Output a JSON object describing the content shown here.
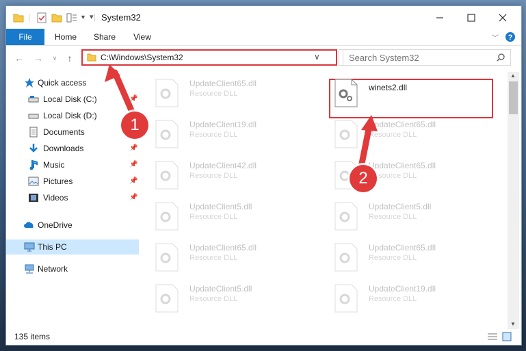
{
  "window": {
    "title": "System32"
  },
  "ribbon": {
    "tabs": [
      "File",
      "Home",
      "Share",
      "View"
    ]
  },
  "nav": {
    "address": "C:\\Windows\\System32",
    "search_placeholder": "Search System32"
  },
  "sidebar": {
    "items": [
      {
        "label": "Quick access",
        "icon": "star-icon",
        "pinned": false,
        "level": 0
      },
      {
        "label": "Local Disk (C:)",
        "icon": "drive-icon",
        "pinned": true,
        "level": 1
      },
      {
        "label": "Local Disk (D:)",
        "icon": "drive-icon",
        "pinned": false,
        "level": 1
      },
      {
        "label": "Documents",
        "icon": "documents-icon",
        "pinned": true,
        "level": 1
      },
      {
        "label": "Downloads",
        "icon": "download-icon",
        "pinned": true,
        "level": 1
      },
      {
        "label": "Music",
        "icon": "music-icon",
        "pinned": true,
        "level": 1
      },
      {
        "label": "Pictures",
        "icon": "pictures-icon",
        "pinned": true,
        "level": 1
      },
      {
        "label": "Videos",
        "icon": "videos-icon",
        "pinned": true,
        "level": 1
      },
      {
        "label": "OneDrive",
        "icon": "cloud-icon",
        "pinned": false,
        "level": 0
      },
      {
        "label": "This PC",
        "icon": "pc-icon",
        "pinned": false,
        "level": 0,
        "selected": true
      },
      {
        "label": "Network",
        "icon": "network-icon",
        "pinned": false,
        "level": 0
      }
    ]
  },
  "files": {
    "left": [
      {
        "name": "UpdateClient65.dll",
        "type": "Resource DLL"
      },
      {
        "name": "UpdateClient19.dll",
        "type": "Resource DLL"
      },
      {
        "name": "UpdateClient42.dll",
        "type": "Resource DLL"
      },
      {
        "name": "UpdateClient5.dll",
        "type": "Resource DLL"
      },
      {
        "name": "UpdateClient65.dll",
        "type": "Resource DLL"
      },
      {
        "name": "UpdateClient5.dll",
        "type": "Resource DLL"
      }
    ],
    "right": [
      {
        "name": "winets2.dll",
        "type": "",
        "highlighted": true
      },
      {
        "name": "UpdateClient65.dll",
        "type": "Resource DLL"
      },
      {
        "name": "UpdateClient65.dll",
        "type": "Resource DLL"
      },
      {
        "name": "UpdateClient5.dll",
        "type": "Resource DLL"
      },
      {
        "name": "UpdateClient65.dll",
        "type": "Resource DLL"
      },
      {
        "name": "UpdateClient19.dll",
        "type": "Resource DLL"
      }
    ]
  },
  "status": {
    "count": "135 items"
  },
  "annotations": {
    "step1": "1",
    "step2": "2"
  },
  "colors": {
    "accent": "#1979ca",
    "highlight": "#d9373d",
    "selected": "#cce8ff"
  }
}
